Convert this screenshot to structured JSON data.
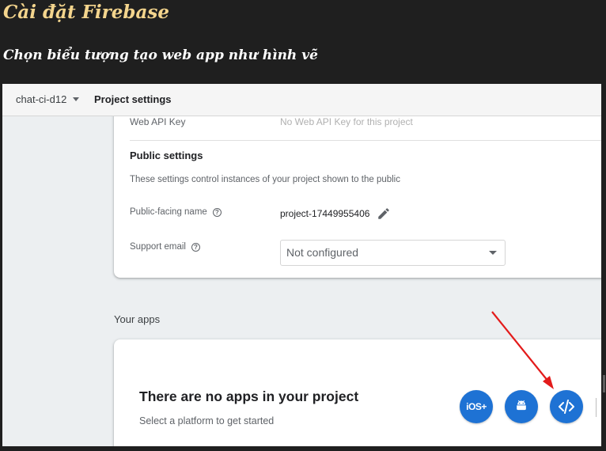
{
  "slide": {
    "title": "Cài đặt Firebase",
    "subtitle": "Chọn biểu tượng tạo web app như hình vẽ"
  },
  "topbar": {
    "project": "chat-ci-d12",
    "page_title": "Project settings"
  },
  "settings": {
    "web_api_key_label": "Web API Key",
    "web_api_key_value": "No Web API Key for this project",
    "public_settings_title": "Public settings",
    "public_settings_desc": "These settings control instances of your project shown to the public",
    "public_name_label": "Public-facing name",
    "public_name_value": "project-17449955406",
    "support_email_label": "Support email",
    "support_email_value": "Not configured"
  },
  "apps": {
    "section_label": "Your apps",
    "empty_title": "There are no apps in your project",
    "empty_subtitle": "Select a platform to get started",
    "ios_label": "iOS+"
  },
  "colors": {
    "accent": "#1e72d4",
    "annotation_arrow": "#e31b1b",
    "slide_title": "#f4d58d"
  }
}
